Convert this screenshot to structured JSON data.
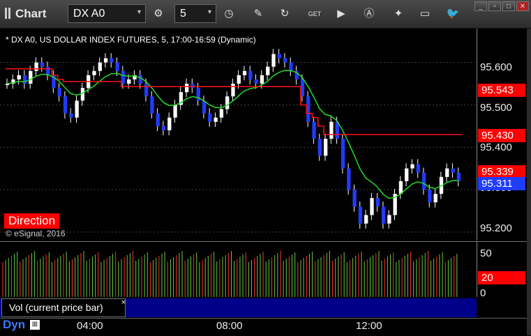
{
  "window": {
    "title": "Chart"
  },
  "toolbar": {
    "symbol": "DX A0",
    "interval": "5",
    "icons": [
      "settings-icon",
      "clock-icon",
      "pencil-icon",
      "refresh-icon",
      "get-icon",
      "play-icon",
      "a-icon",
      "tools-icon",
      "comment-icon",
      "twitter-icon"
    ]
  },
  "window_buttons": [
    "minimize",
    "restore",
    "close"
  ],
  "chart": {
    "header": "* DX A0, US DOLLAR INDEX FUTURES, 5, 17:00-16:59 (Dynamic)",
    "direction_label": "Direction",
    "copyright": "© eSignal, 2016",
    "price_axis": [
      "95.600",
      "95.500",
      "95.400",
      "95.300",
      "95.200"
    ],
    "price_tags": [
      {
        "value": "95.543",
        "color": "#ff0000"
      },
      {
        "value": "95.430",
        "color": "#ff0000"
      },
      {
        "value": "95.339",
        "color": "#ff0000"
      },
      {
        "value": "95.311",
        "color": "#1f3cff"
      }
    ],
    "time_axis": [
      "04:00",
      "08:00",
      "12:00"
    ],
    "dyn_label": "Dyn",
    "vol_label": "Vol (current price bar)",
    "vol_close": "×",
    "vol_axis": [
      "50",
      "0"
    ],
    "vol_tag": "20"
  },
  "chart_data": {
    "type": "candlestick",
    "ylim": [
      95.18,
      95.68
    ],
    "closes": [
      95.55,
      95.56,
      95.57,
      95.55,
      95.58,
      95.6,
      95.59,
      95.57,
      95.54,
      95.52,
      95.48,
      95.47,
      95.51,
      95.54,
      95.57,
      95.58,
      95.6,
      95.61,
      95.6,
      95.58,
      95.55,
      95.56,
      95.57,
      95.55,
      95.52,
      95.48,
      95.45,
      95.44,
      95.47,
      95.5,
      95.53,
      95.55,
      95.54,
      95.51,
      95.48,
      95.46,
      95.47,
      95.49,
      95.52,
      95.55,
      95.57,
      95.58,
      95.56,
      95.55,
      95.57,
      95.59,
      95.62,
      95.61,
      95.6,
      95.58,
      95.56,
      95.52,
      95.46,
      95.42,
      95.38,
      95.42,
      95.46,
      95.42,
      95.35,
      95.3,
      95.26,
      95.22,
      95.24,
      95.28,
      95.26,
      95.22,
      95.24,
      95.29,
      95.32,
      95.35,
      95.36,
      95.34,
      95.3,
      95.27,
      95.29,
      95.33,
      95.35,
      95.34,
      95.32
    ],
    "red_line": [
      95.585,
      95.585,
      95.585,
      95.585,
      95.585,
      95.585,
      95.585,
      95.585,
      95.57,
      95.56,
      95.555,
      95.555,
      95.555,
      95.555,
      95.555,
      95.555,
      95.555,
      95.555,
      95.555,
      95.555,
      95.543,
      95.543,
      95.543,
      95.543,
      95.543,
      95.543,
      95.543,
      95.543,
      95.543,
      95.543,
      95.543,
      95.543,
      95.543,
      95.543,
      95.543,
      95.543,
      95.543,
      95.543,
      95.543,
      95.543,
      95.543,
      95.543,
      95.543,
      95.543,
      95.543,
      95.543,
      95.543,
      95.543,
      95.543,
      95.543,
      95.543,
      95.5,
      95.48,
      95.47,
      95.45,
      95.43,
      95.43,
      95.43,
      95.43,
      95.43,
      95.43,
      95.43,
      95.43,
      95.43,
      95.43,
      95.43,
      95.43,
      95.43,
      95.43,
      95.43,
      95.43,
      95.43,
      95.43,
      95.43,
      95.43,
      95.43,
      95.43,
      95.43,
      95.43
    ],
    "volume_series": [
      "green",
      "red"
    ]
  }
}
